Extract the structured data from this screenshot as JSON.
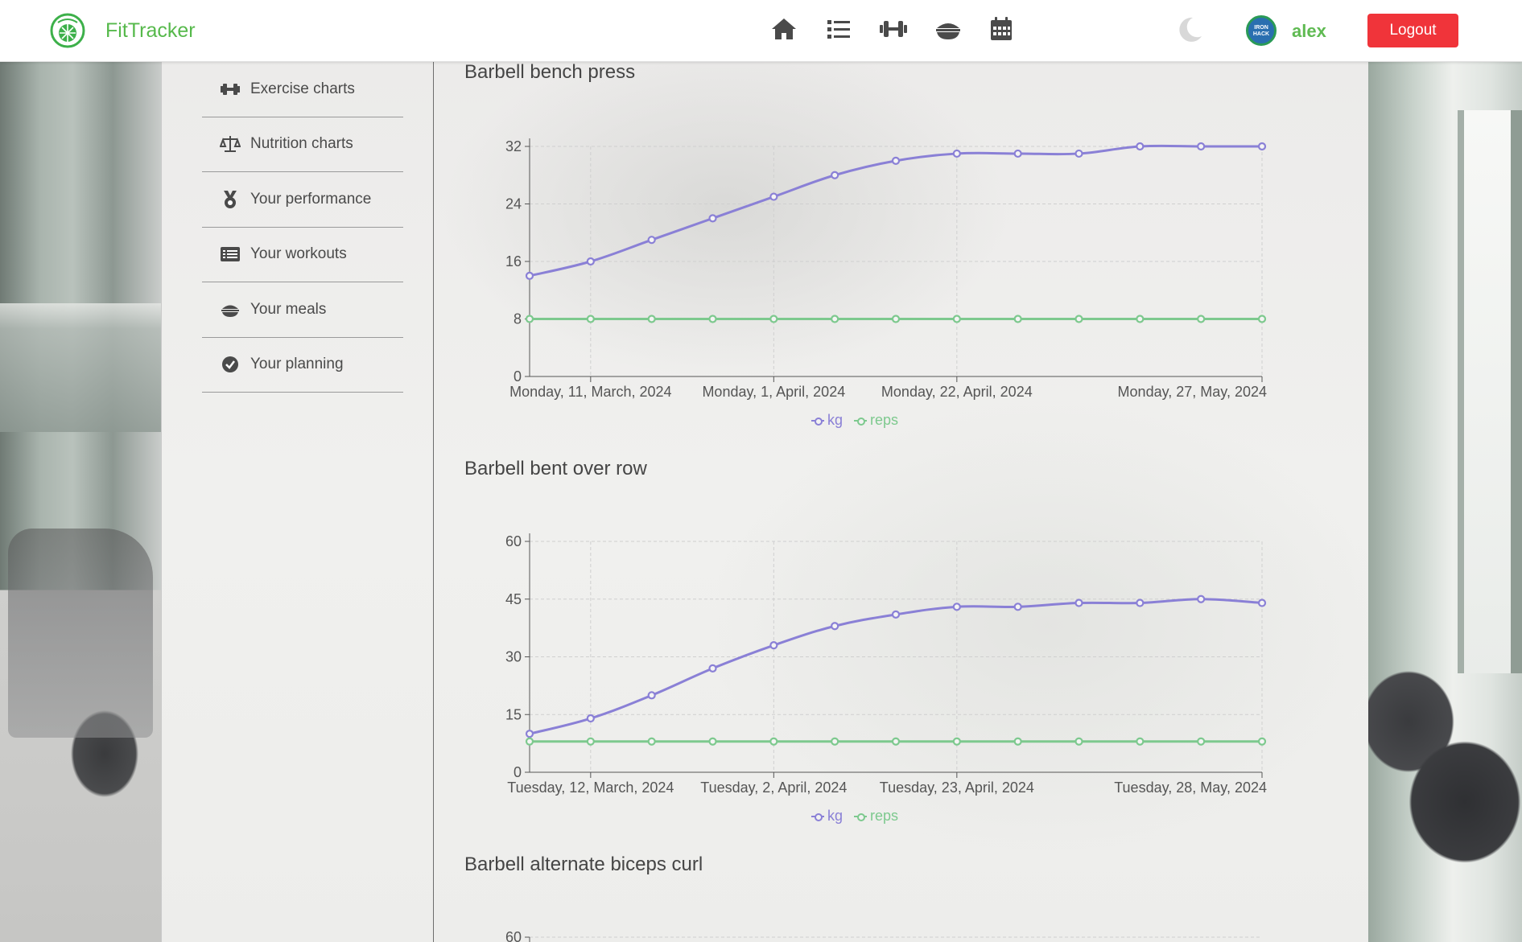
{
  "app": {
    "brand": "FitTracker",
    "brand_color": "#56b94b"
  },
  "header": {
    "nav_icons": [
      "home-icon",
      "list-icon",
      "dumbbell-icon",
      "bowl-icon",
      "calendar-icon"
    ],
    "theme_icon": "moon-icon",
    "avatar_text": "IRON HACK",
    "username": "alex",
    "logout_label": "Logout",
    "logout_color": "#f0343a"
  },
  "sidebar": {
    "items": [
      {
        "label": "Exercise charts",
        "icon": "dumbbell-icon"
      },
      {
        "label": "Nutrition charts",
        "icon": "scale-icon"
      },
      {
        "label": "Your performance",
        "icon": "medal-icon"
      },
      {
        "label": "Your workouts",
        "icon": "list-alt-icon"
      },
      {
        "label": "Your meals",
        "icon": "bowl-icon"
      },
      {
        "label": "Your planning",
        "icon": "check-circle-icon"
      }
    ]
  },
  "colors": {
    "kg": "#8a80d6",
    "reps": "#7dc98e"
  },
  "chart_data": [
    {
      "type": "line",
      "title": "Barbell bench press",
      "x_tick_labels": [
        "Monday, 11, March, 2024",
        "Monday, 1, April, 2024",
        "Monday, 22, April, 2024",
        "Monday, 27, May, 2024"
      ],
      "x_tick_indices": [
        1,
        4,
        7,
        12
      ],
      "yticks": [
        0,
        8,
        16,
        24,
        32
      ],
      "ylim": [
        0,
        32
      ],
      "series": [
        {
          "name": "kg",
          "values": [
            14,
            16,
            19,
            22,
            25,
            28,
            30,
            31,
            31,
            31,
            32,
            32,
            32
          ]
        },
        {
          "name": "reps",
          "values": [
            8,
            8,
            8,
            8,
            8,
            8,
            8,
            8,
            8,
            8,
            8,
            8,
            8
          ]
        }
      ]
    },
    {
      "type": "line",
      "title": "Barbell bent over row",
      "x_tick_labels": [
        "Tuesday, 12, March, 2024",
        "Tuesday, 2, April, 2024",
        "Tuesday, 23, April, 2024",
        "Tuesday, 28, May, 2024"
      ],
      "x_tick_indices": [
        1,
        4,
        7,
        12
      ],
      "yticks": [
        0,
        15,
        30,
        45,
        60
      ],
      "ylim": [
        0,
        60
      ],
      "series": [
        {
          "name": "kg",
          "values": [
            10,
            14,
            20,
            27,
            33,
            38,
            41,
            43,
            43,
            44,
            44,
            45,
            44
          ]
        },
        {
          "name": "reps",
          "values": [
            8,
            8,
            8,
            8,
            8,
            8,
            8,
            8,
            8,
            8,
            8,
            8,
            8
          ]
        }
      ]
    },
    {
      "type": "line",
      "title": "Barbell alternate biceps curl",
      "yticks": [
        60
      ],
      "ylim": [
        0,
        60
      ],
      "series": []
    }
  ]
}
